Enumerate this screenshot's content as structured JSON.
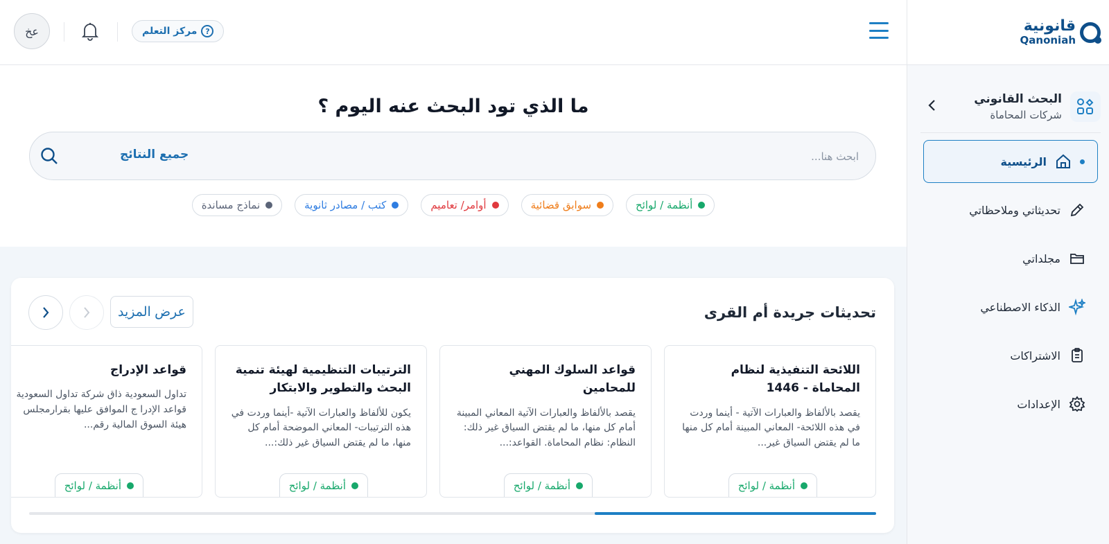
{
  "brand": {
    "name_ar": "قانونية",
    "name_en": "Qanoniah",
    "color": "#0e4f8a"
  },
  "accent_color": "#1d7fc4",
  "workspace": {
    "title": "البحث القانوني",
    "subtitle": "شركات المحاماة"
  },
  "nav": {
    "items": [
      {
        "label": "الرئيسية",
        "icon": "home-icon",
        "active": true
      },
      {
        "label": "تحديثاتي وملاحظاتي",
        "icon": "pencil-icon",
        "active": false
      },
      {
        "label": "مجلداتي",
        "icon": "folder-icon",
        "active": false
      },
      {
        "label": "الذكاء الاصطناعي",
        "icon": "sparkle-icon",
        "active": false
      },
      {
        "label": "الاشتراكات",
        "icon": "clipboard-icon",
        "active": false
      },
      {
        "label": "الإعدادات",
        "icon": "gear-icon",
        "active": false
      }
    ]
  },
  "header": {
    "avatar_initials": "عخ",
    "learning_center": "مركز التعلم"
  },
  "search": {
    "title": "ما الذي تود البحث عنه اليوم ؟",
    "placeholder": "ابحث هنا...",
    "value": "",
    "scope": "جميع النتائج"
  },
  "filters": [
    {
      "label": "أنظمة / لوائح",
      "color": "#17a86b"
    },
    {
      "label": "سوابق قضائية",
      "color": "#ef7d1a"
    },
    {
      "label": "أوامر/ تعاميم",
      "color": "#e0393e"
    },
    {
      "label": "كتب / مصادر ثانوية",
      "color": "#2f7de1"
    },
    {
      "label": "نماذج مساندة",
      "color": "#5b6478"
    }
  ],
  "updates": {
    "title": "تحديثات جريدة أم القرى",
    "more_label": "عرض المزيد",
    "scroll_position": 0.667,
    "cards": [
      {
        "title": "اللائحة التنفيذية لنظام المحاماة - 1446",
        "excerpt": "يقصد بالألفاظ والعبارات الآتية - أينما وردت في هذه اللائحة- المعاني المبينة أمام كل منها ما لم يقتض السياق غير...",
        "tag": "أنظمة / لوائح"
      },
      {
        "title": "قواعد السلوك المهني للمحامين",
        "excerpt": "يقصد بالألفاظ والعبارات الآتية المعاني المبينة أمام كل منها، ما لم يقتض السياق غير ذلك: النظام: نظام المحاماة. القواعد:...",
        "tag": "أنظمة / لوائح"
      },
      {
        "title": "الترتيبات التنظيمية لهيئة تنمية البحث والتطوير والابتكار",
        "excerpt": "يكون للألفاظ والعبارات الآتية -أينما وردت في هذه الترتيبات- المعاني الموضحة أمام كل منها، ما لم يقتض السياق غير ذلك:...",
        "tag": "أنظمة / لوائح"
      },
      {
        "title": "قواعد الإدراج",
        "excerpt": "تداول السعودية ذاق شركة تداول السعودية قواعد الإدرا ج الموافق عليها بقرارمجلس هيئة السوق المالية رقم...",
        "tag": "أنظمة / لوائح"
      }
    ]
  }
}
